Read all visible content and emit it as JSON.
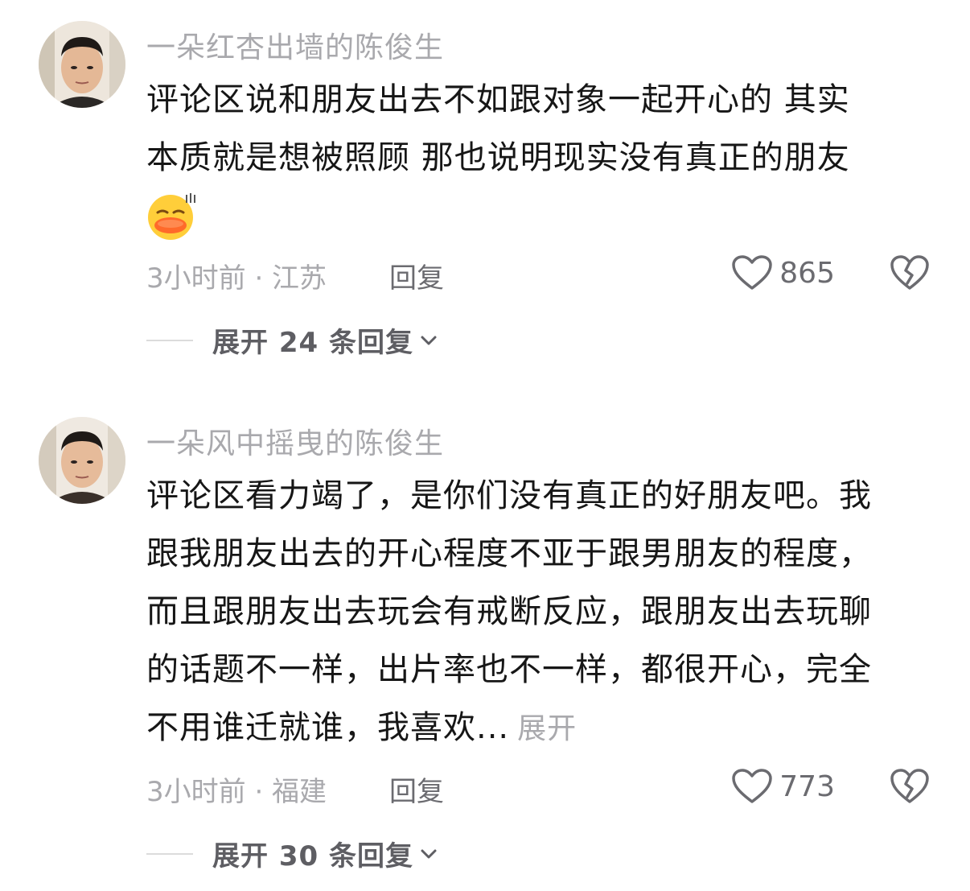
{
  "comments": [
    {
      "username": "一朵红杏出墙的陈俊生",
      "text_lines": [
        "评论区说和朋友出去不如跟对象一起开心的 其实",
        "本质就是想被照顾 那也说明现实没有真正的朋友"
      ],
      "emoji": "laughing-duck-emoji",
      "meta": "3小时前 · 江苏",
      "reply_label": "回复",
      "likes": "865",
      "expand_replies": "展开 24 条回复"
    },
    {
      "username": "一朵风中摇曳的陈俊生",
      "text_lines": [
        "评论区看力竭了，是你们没有真正的好朋友吧。我",
        "跟我朋友出去的开心程度不亚于跟男朋友的程度，",
        "而且跟朋友出去玩会有戒断反应，跟朋友出去玩聊",
        "的话题不一样，出片率也不一样，都很开心，完全",
        "不用谁迁就谁，我喜欢..."
      ],
      "inline_expand": "展开",
      "meta": "3小时前 · 福建",
      "reply_label": "回复",
      "likes": "773",
      "expand_replies": "展开 30 条回复"
    }
  ],
  "icons": {
    "like": "heart-outline-icon",
    "dislike": "broken-heart-icon",
    "chevron": "chevron-down-icon"
  },
  "colors": {
    "username": "#a9a9ad",
    "body_text": "#161616",
    "meta": "#a9a9ad",
    "action": "#6b6b70"
  }
}
